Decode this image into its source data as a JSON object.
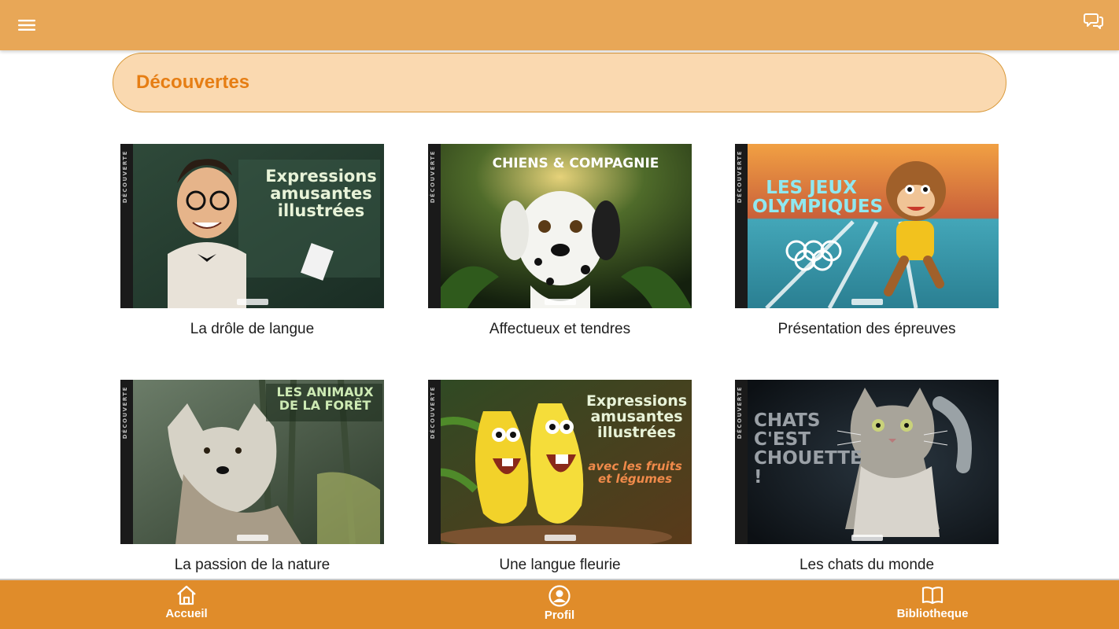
{
  "header": {
    "menu_icon": "hamburger-menu-icon",
    "chat_icon": "chat-bubbles-icon"
  },
  "section": {
    "title": "Découvertes"
  },
  "cards": [
    {
      "label": "La drôle de langue",
      "cover_text": "Expressions\namusantes\nillustrées",
      "spine_text": "DÉCOUVERTE"
    },
    {
      "label": "Affectueux et tendres",
      "cover_text": "CHIENS & COMPAGNIE",
      "spine_text": "DÉCOUVERTE"
    },
    {
      "label": "Présentation des épreuves",
      "cover_text": "LES JEUX\nOLYMPIQUES",
      "spine_text": "DÉCOUVERTE"
    },
    {
      "label": "La passion de la nature",
      "cover_text": "LES ANIMAUX\nDE LA FORÊT",
      "spine_text": "DÉCOUVERTE"
    },
    {
      "label": "Une langue fleurie",
      "cover_text": "Expressions\namusantes\nillustrées",
      "cover_subtext": "avec les fruits\net légumes",
      "spine_text": "DÉCOUVERTE"
    },
    {
      "label": "Les chats du monde",
      "cover_text": "CHATS\nC'EST\nCHOUETTE !",
      "spine_text": "DÉCOUVERTE"
    }
  ],
  "bottom_nav": {
    "items": [
      {
        "label": "Accueil",
        "icon": "home-icon"
      },
      {
        "label": "Profil",
        "icon": "profile-icon"
      },
      {
        "label": "Bibliotheque",
        "icon": "book-icon"
      }
    ]
  },
  "colors": {
    "topbar": "#e8a757",
    "bottombar": "#e08c2a",
    "section_bg": "#fad9b0",
    "section_title": "#e67e14"
  }
}
